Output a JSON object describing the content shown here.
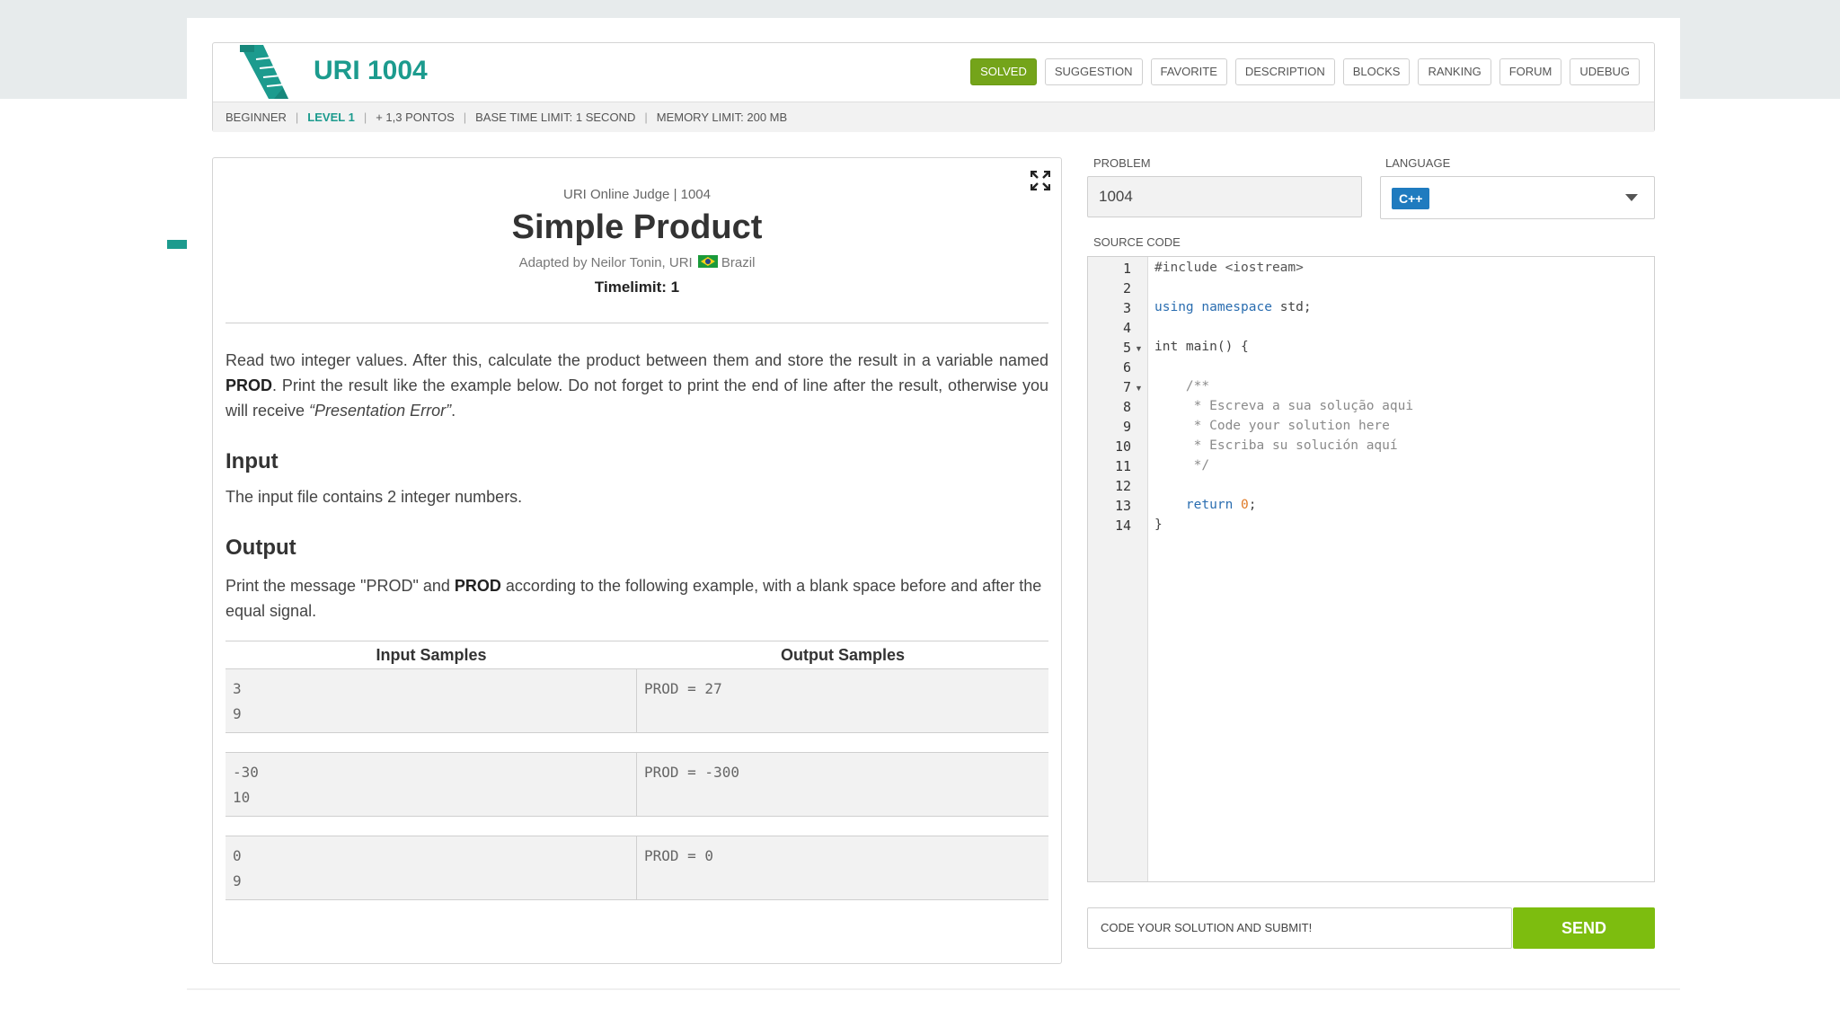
{
  "header": {
    "title": "URI 1004",
    "tabs": [
      "SOLVED",
      "SUGGESTION",
      "FAVORITE",
      "DESCRIPTION",
      "BLOCKS",
      "RANKING",
      "FORUM",
      "UDEBUG"
    ],
    "meta": {
      "category": "BEGINNER",
      "level": "LEVEL 1",
      "points": "+ 1,3 PONTOS",
      "time_limit": "BASE TIME LIMIT: 1 SECOND",
      "memory_limit": "MEMORY LIMIT: 200 MB"
    }
  },
  "problem": {
    "source": "URI Online Judge | 1004",
    "title": "Simple Product",
    "adapted_prefix": "Adapted by Neilor Tonin, URI",
    "adapted_country": "Brazil",
    "timelimit": "Timelimit: 1",
    "desc_part1": "Read two integer values. After this, calculate the product between them and store the result in a variable named ",
    "desc_bold": "PROD",
    "desc_part2": ". Print the result like the example below. Do not forget to print the end of line after the result, otherwise you will receive ",
    "desc_italic": "“Presentation Error”",
    "desc_end": ".",
    "input_heading": "Input",
    "input_text": "The input file contains 2 integer numbers.",
    "output_heading": "Output",
    "output_part1": "Print the message \"PROD\" and ",
    "output_bold": "PROD",
    "output_part2": " according to the following example, with a blank space before and after the equal signal.",
    "samples_header_input": "Input Samples",
    "samples_header_output": "Output Samples",
    "samples": [
      {
        "input": "3\n9",
        "output": "PROD = 27"
      },
      {
        "input": "-30\n10",
        "output": "PROD = -300"
      },
      {
        "input": "0\n9",
        "output": "PROD = 0"
      }
    ]
  },
  "form": {
    "problem_label": "PROBLEM",
    "problem_value": "1004",
    "language_label": "LANGUAGE",
    "language_value": "C++",
    "source_label": "SOURCE CODE",
    "submit_placeholder": "CODE YOUR SOLUTION AND SUBMIT!",
    "send_label": "SEND"
  },
  "code": {
    "line_numbers": [
      "1",
      "2",
      "3",
      "4",
      "5",
      "6",
      "7",
      "8",
      "9",
      "10",
      "11",
      "12",
      "13",
      "14"
    ],
    "l1": "#include <iostream>",
    "l3_kw1": "using",
    "l3_kw2": "namespace",
    "l3_rest": " std;",
    "l5": "int main() {",
    "l7": "    /**",
    "l8": "     * Escreva a sua solução aqui",
    "l9": "     * Code your solution here",
    "l10": "     * Escriba su solución aquí",
    "l11": "     */",
    "l13_kw": "return",
    "l13_num": "0",
    "l14": "}"
  },
  "colors": {
    "accent": "#1c9b8e",
    "solved": "#74a41a",
    "send": "#7dbd0f",
    "language_badge": "#1f7bbf"
  }
}
